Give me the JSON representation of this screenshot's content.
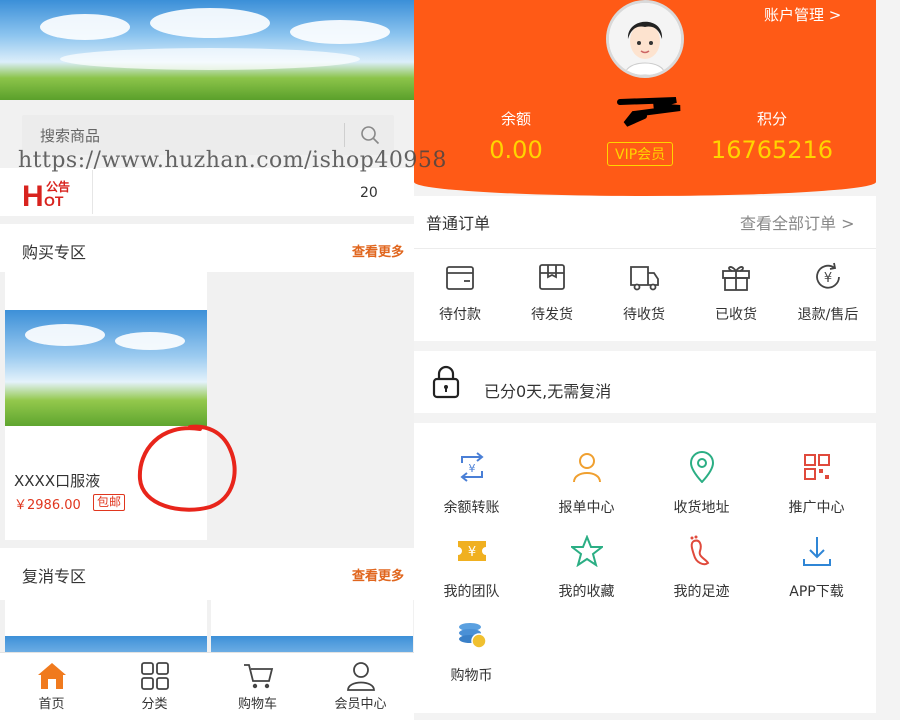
{
  "watermark": "https://www.huzhan.com/ishop40958",
  "left": {
    "search": {
      "placeholder": "搜索商品"
    },
    "notice": {
      "logo_text": "公告",
      "logo_hot": "HOT",
      "count": "20"
    },
    "buy_section": {
      "title": "购买专区",
      "more": "查看更多"
    },
    "product": {
      "name": "XXXX口服液",
      "price": "￥2986.00",
      "tag": "包邮"
    },
    "resale_section": {
      "title": "复消专区",
      "more": "查看更多"
    },
    "tabbar": [
      {
        "label": "首页",
        "icon": "home-icon",
        "active": true
      },
      {
        "label": "分类",
        "icon": "grid-icon"
      },
      {
        "label": "购物车",
        "icon": "cart-icon"
      },
      {
        "label": "会员中心",
        "icon": "user-icon"
      }
    ]
  },
  "right": {
    "account_link": "账户管理 >",
    "stats": {
      "balance_label": "余额",
      "balance_value": "0.00",
      "vip": "VIP会员",
      "points_label": "积分",
      "points_value": "16765216"
    },
    "orders": {
      "title": "普通订单",
      "view_all": "查看全部订单 >",
      "items": [
        {
          "label": "待付款",
          "icon": "wallet-icon"
        },
        {
          "label": "待发货",
          "icon": "box-icon"
        },
        {
          "label": "待收货",
          "icon": "truck-icon"
        },
        {
          "label": "已收货",
          "icon": "gift-icon"
        },
        {
          "label": "退款/售后",
          "icon": "refund-icon"
        }
      ]
    },
    "lock_notice": "已分0天,无需复消",
    "menu": [
      {
        "label": "余额转账",
        "icon": "transfer-icon"
      },
      {
        "label": "报单中心",
        "icon": "person-icon"
      },
      {
        "label": "收货地址",
        "icon": "location-icon"
      },
      {
        "label": "推广中心",
        "icon": "qrcode-icon"
      },
      {
        "label": "我的团队",
        "icon": "ticket-icon"
      },
      {
        "label": "我的收藏",
        "icon": "star-icon"
      },
      {
        "label": "我的足迹",
        "icon": "footprint-icon"
      },
      {
        "label": "APP下载",
        "icon": "download-icon"
      },
      {
        "label": "购物币",
        "icon": "coins-icon"
      }
    ],
    "colors": {
      "accent": "#ff5a16",
      "highlight": "#ffd400",
      "annotation": "#e8251b"
    }
  }
}
